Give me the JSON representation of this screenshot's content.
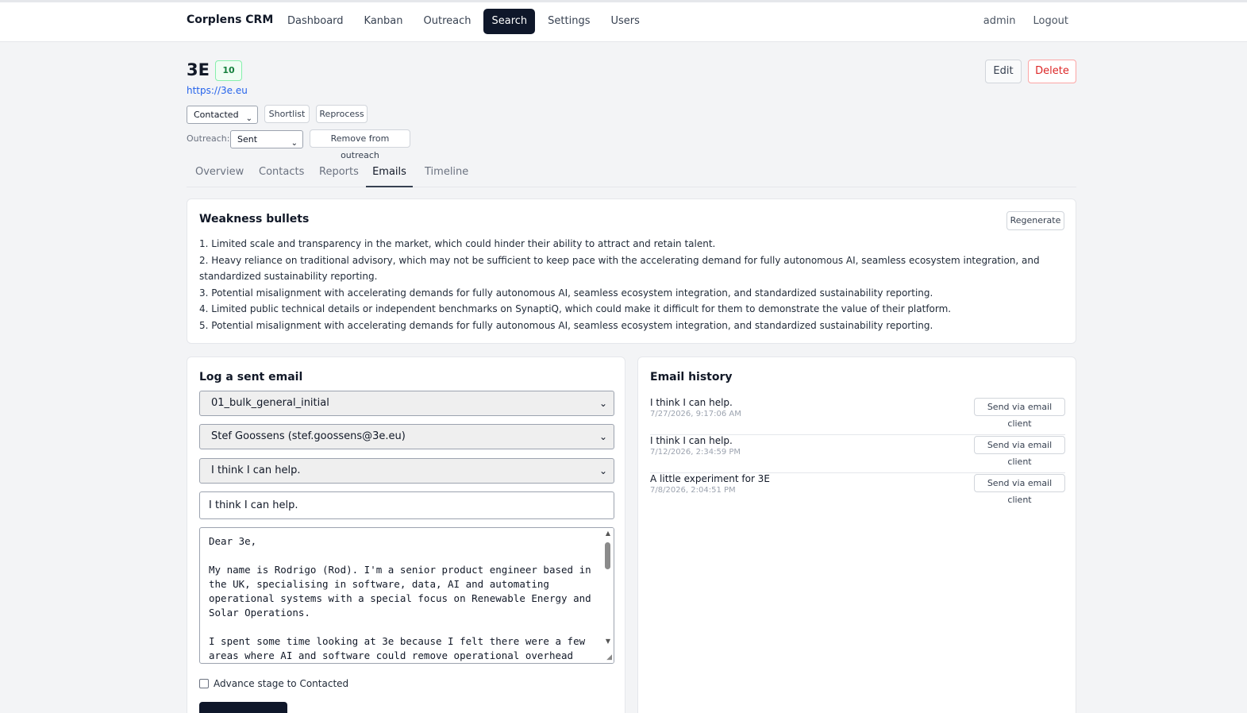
{
  "app": {
    "brand": "Corplens CRM",
    "nav": [
      "Dashboard",
      "Kanban",
      "Outreach",
      "Search",
      "Settings",
      "Users"
    ],
    "active_nav": "Search",
    "user": "admin",
    "logout": "Logout"
  },
  "company": {
    "name": "3E",
    "score": "10",
    "url": "https://3e.eu",
    "edit_label": "Edit",
    "delete_label": "Delete",
    "stage": "Contacted",
    "shortlist_label": "Shortlist",
    "reprocess_label": "Reprocess",
    "outreach_label": "Outreach:",
    "outreach_status": "Sent",
    "remove_label": "Remove from outreach"
  },
  "tabs": [
    "Overview",
    "Contacts",
    "Reports",
    "Emails",
    "Timeline"
  ],
  "active_tab": "Emails",
  "weakness": {
    "title": "Weakness bullets",
    "regenerate_label": "Regenerate",
    "bullets": [
      "1. Limited scale and transparency in the market, which could hinder their ability to attract and retain talent.",
      "2. Heavy reliance on traditional advisory, which may not be sufficient to keep pace with the accelerating demand for fully autonomous AI, seamless ecosystem integration, and standardized sustainability reporting.",
      "3. Potential misalignment with accelerating demands for fully autonomous AI, seamless ecosystem integration, and standardized sustainability reporting.",
      "4. Limited public technical details or independent benchmarks on SynaptiQ, which could make it difficult for them to demonstrate the value of their platform.",
      "5. Potential misalignment with accelerating demands for fully autonomous AI, seamless ecosystem integration, and standardized sustainability reporting."
    ]
  },
  "log_email": {
    "title": "Log a sent email",
    "template": "01_bulk_general_initial",
    "contact": "Stef Goossens (stef.goossens@3e.eu)",
    "subject_option": "I think I can help.",
    "subject_value": "I think I can help.",
    "body": "Dear 3e,\n\nMy name is Rodrigo (Rod). I'm a senior product engineer based in the UK, specialising in software, data, AI and automating operational systems with a special focus on Renewable Energy and Solar Operations.\n\nI spent some time looking at 3e because I felt there were a few areas where AI and software could remove operational overhead",
    "advance_label": "Advance stage to Contacted",
    "advance_checked": false
  },
  "history": {
    "title": "Email history",
    "send_label": "Send via email client",
    "items": [
      {
        "subject": "I think I can help.",
        "date": "7/27/2026, 9:17:06 AM"
      },
      {
        "subject": "I think I can help.",
        "date": "7/12/2026, 2:34:59 PM"
      },
      {
        "subject": "A little experiment for 3E",
        "date": "7/8/2026, 2:04:51 PM"
      }
    ]
  }
}
